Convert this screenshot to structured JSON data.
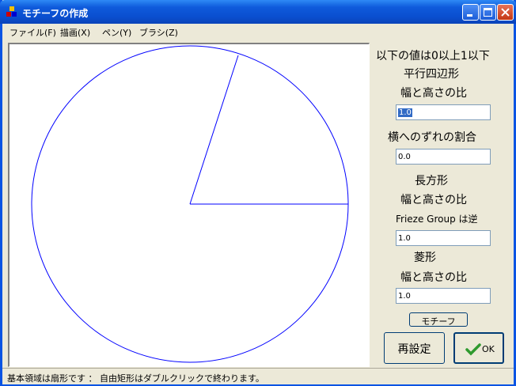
{
  "window": {
    "title": "モチーフの作成"
  },
  "menu": [
    {
      "label": "ファイル(F)"
    },
    {
      "label": "描画(X)"
    },
    {
      "label": "ペン(Y)"
    },
    {
      "label": "ブラシ(Z)"
    }
  ],
  "canvas": {
    "stroke_color": "#0000ff"
  },
  "panel": {
    "header": "以下の値は0以上1以下",
    "parallelogram_title": "平行四辺形",
    "parallelogram_ratio_label": "幅と高さの比",
    "parallelogram_ratio_value": "1.0",
    "shift_label": "横へのずれの割合",
    "shift_value": "0.0",
    "rectangle_title": "長方形",
    "rectangle_ratio_label": "幅と高さの比",
    "frieze_label": "Frieze Group は逆",
    "rectangle_ratio_value": "1.0",
    "rhombus_title": "菱形",
    "rhombus_ratio_label": "幅と高さの比",
    "rhombus_ratio_value": "1.0",
    "motif_button": "モチーフ",
    "reset_button": "再設定",
    "ok_button": "OK"
  },
  "status": {
    "text": "基本領域は扇形です ： 自由矩形はダブルクリックで終わります。"
  },
  "colors": {
    "titlebar": "#0a54e3",
    "window_bg": "#ece9d8",
    "ok_check": "#2f9a2f"
  }
}
